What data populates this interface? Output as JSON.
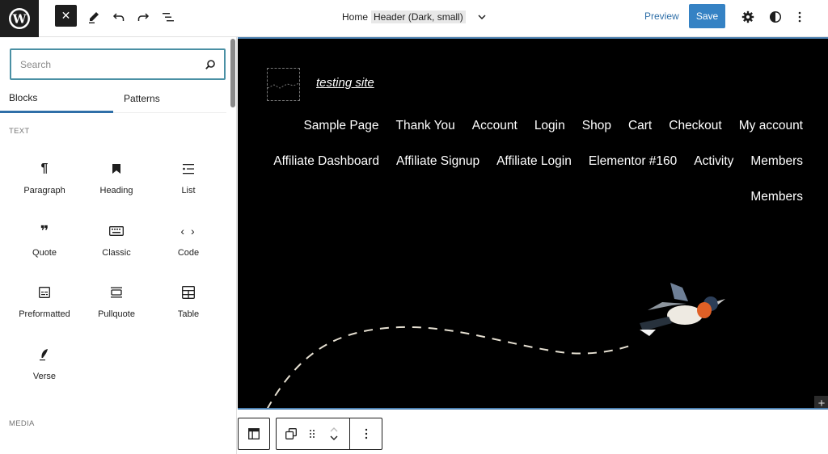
{
  "topbar": {
    "logo": "W",
    "close_icon": "✕",
    "tools_icon": "✎",
    "undo_icon": "↶",
    "redo_icon": "↷",
    "list_view_icon": "☰",
    "document": {
      "page": "Home",
      "template": "Header (Dark, small)",
      "chevron": "⌄"
    },
    "preview_label": "Preview",
    "save_label": "Save",
    "settings_icon": "⚙",
    "styles_icon": "◐",
    "options_icon": "⋮",
    "accent": "#3582c4"
  },
  "sidebar": {
    "search": {
      "placeholder": "Search",
      "value": "",
      "icon": "⌕"
    },
    "tabs": [
      {
        "label": "Blocks",
        "active": true
      },
      {
        "label": "Patterns",
        "active": false
      }
    ],
    "sections": [
      {
        "label": "TEXT",
        "blocks": [
          {
            "label": "Paragraph",
            "icon": "¶"
          },
          {
            "label": "Heading",
            "icon": "🔖"
          },
          {
            "label": "List",
            "icon": "☷"
          },
          {
            "label": "Quote",
            "icon": "❞"
          },
          {
            "label": "Classic",
            "icon": "⌨"
          },
          {
            "label": "Code",
            "icon": "‹ ›"
          },
          {
            "label": "Preformatted",
            "icon": "⊟"
          },
          {
            "label": "Pullquote",
            "icon": "▭"
          },
          {
            "label": "Table",
            "icon": "⊞"
          },
          {
            "label": "Verse",
            "icon": "✒"
          }
        ]
      },
      {
        "label": "MEDIA",
        "blocks": []
      }
    ]
  },
  "canvas": {
    "site_title": "testing site",
    "nav_rows": [
      [
        "Sample Page",
        "Thank You",
        "Account",
        "Login",
        "Shop",
        "Cart",
        "Checkout",
        "My account"
      ],
      [
        "Affiliate Dashboard",
        "Affiliate Signup",
        "Affiliate Login",
        "Elementor #160",
        "Activity",
        "Members"
      ],
      [
        "Members"
      ]
    ],
    "inserter_icon": "+"
  },
  "block_toolbar": {
    "parent_icon": "▤",
    "transform_icon": "⧉",
    "drag_icon": "⠿",
    "move_up_icon": "˄",
    "move_down_icon": "˅",
    "more_icon": "⋮"
  }
}
